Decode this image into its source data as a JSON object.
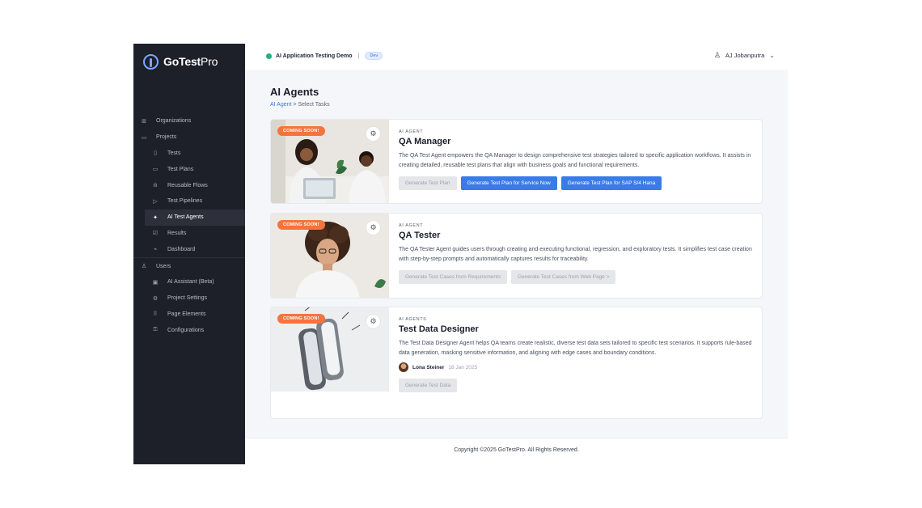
{
  "brand": {
    "name_bold": "GoTest",
    "name_light": "Pro",
    "accent": "#7aa7ff"
  },
  "sidebar": {
    "items": [
      {
        "label": "Organizations",
        "icon": "org-icon",
        "glyph": "⊞"
      },
      {
        "label": "Projects",
        "icon": "folder-icon",
        "glyph": "▭"
      },
      {
        "label": "Tests",
        "icon": "file-icon",
        "glyph": "▯"
      },
      {
        "label": "Test Plans",
        "icon": "folder-icon",
        "glyph": "▭"
      },
      {
        "label": "Reusable Flows",
        "icon": "flow-icon",
        "glyph": "ılı"
      },
      {
        "label": "Test Pipelines",
        "icon": "play-icon",
        "glyph": "▷"
      },
      {
        "label": "AI Test Agents",
        "icon": "agent-icon",
        "glyph": "✦"
      },
      {
        "label": "Results",
        "icon": "check-icon",
        "glyph": "☑"
      },
      {
        "label": "Dashboard",
        "icon": "chart-icon",
        "glyph": "⌁"
      },
      {
        "label": "Users",
        "icon": "user-icon",
        "glyph": "♙"
      },
      {
        "label": "AI Assistant (Beta)",
        "icon": "assistant-icon",
        "glyph": "▣"
      },
      {
        "label": "Project Settings",
        "icon": "settings-icon",
        "glyph": "⚙"
      },
      {
        "label": "Page Elements",
        "icon": "elements-icon",
        "glyph": "⠿"
      },
      {
        "label": "Configurations",
        "icon": "config-icon",
        "glyph": "⚿"
      }
    ]
  },
  "topbar": {
    "project_name": "AI Application Testing Demo",
    "separator": "|",
    "env_badge": "Dev",
    "user_name": "AJ Jobanputra"
  },
  "main": {
    "title": "AI Agents",
    "breadcrumb_link": "AI Agent",
    "breadcrumb_rest": " > Select Tasks"
  },
  "cards": [
    {
      "badge": "COMING SOON!",
      "kicker": "AI AGENT",
      "title": "QA Manager",
      "description": "The QA Test Agent empowers the QA Manager to design comprehensive test strategies tailored to specific application workflows. It assists in creating detailed, reusable test plans that align with business goals and functional requirements.",
      "buttons": [
        {
          "label": "Generate Test Plan",
          "disabled": true
        },
        {
          "label": "Generate Test Plan for Service Now",
          "disabled": false
        },
        {
          "label": "Generate Test Plan for SAP S/4 Hana",
          "disabled": false
        }
      ]
    },
    {
      "badge": "COMING SOON!",
      "kicker": "AI AGENT",
      "title": "QA Tester",
      "description": "The QA Tester Agent guides users through creating and executing functional, regression, and exploratory tests. It simplifies test case creation with step-by-step prompts and automatically captures results for traceability.",
      "buttons": [
        {
          "label": "Generate Test Cases from Requirements",
          "disabled": true
        },
        {
          "label": "Generate Test Cases from Web Page >",
          "disabled": true
        }
      ]
    },
    {
      "badge": "COMING SOON!",
      "kicker": "AI AGENTS",
      "title": "Test Data Designer",
      "description": "The Test Data Designer Agent helps QA teams create realistic, diverse test data sets tailored to specific test scenarios. It supports rule-based data generation, masking sensitive information, and aligning with edge cases and boundary conditions.",
      "author": {
        "name": "Lona Steiner",
        "date": "18 Jan 2025"
      },
      "buttons": [
        {
          "label": "Generate Test Data",
          "disabled": true
        }
      ]
    }
  ],
  "footer": {
    "text": "Copyright ©2025 GoTestPro. All Rights Reserved."
  },
  "colors": {
    "sidebar_bg": "#1e2029",
    "primary": "#3b7be8",
    "badge": "#f5743e",
    "status_green": "#22b07d"
  }
}
